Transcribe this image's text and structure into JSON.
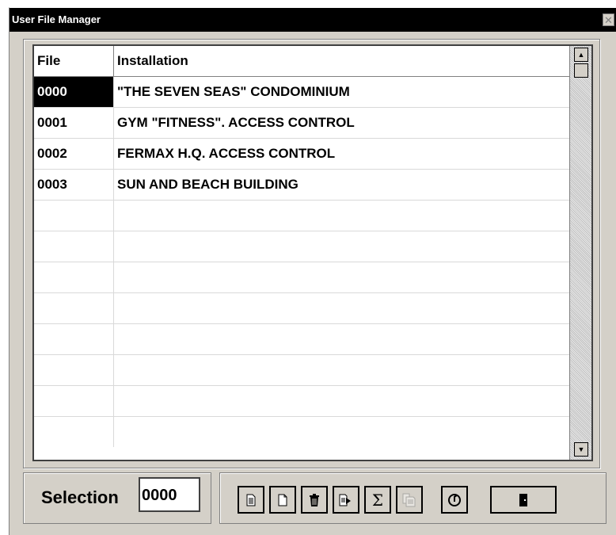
{
  "window": {
    "title": "User File Manager",
    "close_glyph": "✕"
  },
  "grid": {
    "columns": [
      "File",
      "Installation"
    ],
    "rows": [
      {
        "file": "0000",
        "installation": "\"THE SEVEN SEAS\" CONDOMINIUM",
        "selected": true
      },
      {
        "file": "0001",
        "installation": "GYM \"FITNESS\". ACCESS CONTROL"
      },
      {
        "file": "0002",
        "installation": "FERMAX H.Q. ACCESS CONTROL"
      },
      {
        "file": "0003",
        "installation": "SUN AND BEACH BUILDING"
      }
    ],
    "empty_rows": 8
  },
  "selection": {
    "label": "Selection",
    "value": "0000"
  },
  "toolbar": {
    "buttons": [
      {
        "name": "document-icon"
      },
      {
        "name": "new-file-icon"
      },
      {
        "name": "trash-icon"
      },
      {
        "name": "export-icon"
      },
      {
        "name": "sigma-icon",
        "glyph": "Σ"
      },
      {
        "name": "copy-icon"
      },
      {
        "name": "refresh-icon"
      },
      {
        "name": "exit-door-icon"
      }
    ]
  },
  "colors": {
    "window_bg": "#d4d0c8",
    "titlebar_bg": "#000000",
    "selected_bg": "#000000"
  }
}
